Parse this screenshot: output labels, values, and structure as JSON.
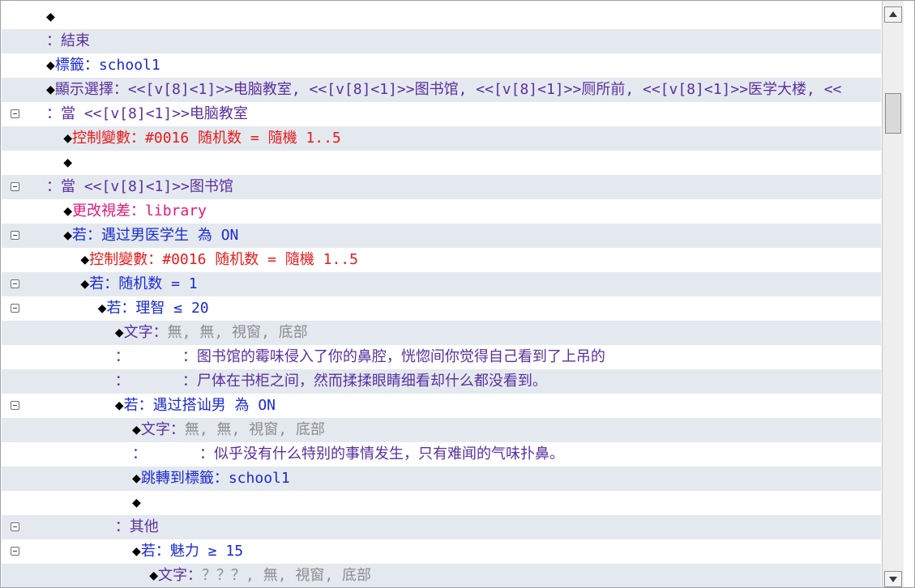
{
  "lines": [
    {
      "indent": 0,
      "fold": false,
      "segs": [
        {
          "t": "◆",
          "c": "dia"
        }
      ]
    },
    {
      "indent": 0,
      "fold": false,
      "segs": [
        {
          "t": "：結束",
          "c": "p"
        }
      ]
    },
    {
      "indent": 0,
      "fold": false,
      "segs": [
        {
          "t": "◆",
          "c": "dia"
        },
        {
          "t": "標籤：school1",
          "c": "b"
        }
      ]
    },
    {
      "indent": 0,
      "fold": false,
      "segs": [
        {
          "t": "◆",
          "c": "dia"
        },
        {
          "t": "顯示選擇：<<[v[8]<1]>>电脑教室, <<[v[8]<1]>>图书馆, <<[v[8]<1]>>厕所前, <<[v[8]<1]>>医学大楼, <<",
          "c": "p"
        }
      ]
    },
    {
      "indent": 0,
      "fold": true,
      "segs": [
        {
          "t": "：當 <<[v[8]<1]>>电脑教室",
          "c": "p"
        }
      ]
    },
    {
      "indent": 1,
      "fold": false,
      "segs": [
        {
          "t": "◆",
          "c": "dia"
        },
        {
          "t": "控制變數：#0016 随机数 = 隨機 1..5",
          "c": "r"
        }
      ]
    },
    {
      "indent": 1,
      "fold": false,
      "segs": [
        {
          "t": "◆",
          "c": "dia"
        }
      ]
    },
    {
      "indent": 0,
      "fold": true,
      "segs": [
        {
          "t": "：當 <<[v[8]<1]>>图书馆",
          "c": "p"
        }
      ]
    },
    {
      "indent": 1,
      "fold": false,
      "segs": [
        {
          "t": "◆",
          "c": "dia"
        },
        {
          "t": "更改視差：library",
          "c": "m"
        }
      ]
    },
    {
      "indent": 1,
      "fold": true,
      "segs": [
        {
          "t": "◆",
          "c": "dia"
        },
        {
          "t": "若：遇过男医学生 為 ON",
          "c": "b"
        }
      ]
    },
    {
      "indent": 2,
      "fold": false,
      "segs": [
        {
          "t": "◆",
          "c": "dia"
        },
        {
          "t": "控制變數：#0016 随机数 = 隨機 1..5",
          "c": "r"
        }
      ]
    },
    {
      "indent": 2,
      "fold": true,
      "segs": [
        {
          "t": "◆",
          "c": "dia"
        },
        {
          "t": "若：随机数 = 1",
          "c": "b"
        }
      ]
    },
    {
      "indent": 3,
      "fold": true,
      "segs": [
        {
          "t": "◆",
          "c": "dia"
        },
        {
          "t": "若：理智 ≤ 20",
          "c": "b"
        }
      ]
    },
    {
      "indent": 4,
      "fold": false,
      "segs": [
        {
          "t": "◆",
          "c": "dia"
        },
        {
          "t": "文字：",
          "c": "p"
        },
        {
          "t": "無, 無, 視窗, 底部",
          "c": "g"
        }
      ]
    },
    {
      "indent": 4,
      "fold": false,
      "segs": [
        {
          "t": "：      ：图书馆的霉味侵入了你的鼻腔，恍惚间你觉得自己看到了上吊的",
          "c": "p"
        }
      ]
    },
    {
      "indent": 4,
      "fold": false,
      "segs": [
        {
          "t": "：      ：尸体在书柜之间，然而揉揉眼睛细看却什么都没看到。",
          "c": "p"
        }
      ]
    },
    {
      "indent": 4,
      "fold": true,
      "segs": [
        {
          "t": "◆",
          "c": "dia"
        },
        {
          "t": "若：遇过搭讪男 為 ON",
          "c": "b"
        }
      ]
    },
    {
      "indent": 5,
      "fold": false,
      "segs": [
        {
          "t": "◆",
          "c": "dia"
        },
        {
          "t": "文字：",
          "c": "p"
        },
        {
          "t": "無, 無, 視窗, 底部",
          "c": "g"
        }
      ]
    },
    {
      "indent": 5,
      "fold": false,
      "segs": [
        {
          "t": "：      ：似乎没有什么特别的事情发生，只有难闻的气味扑鼻。",
          "c": "p"
        }
      ]
    },
    {
      "indent": 5,
      "fold": false,
      "segs": [
        {
          "t": "◆",
          "c": "dia"
        },
        {
          "t": "跳轉到標籤：school1",
          "c": "b"
        }
      ]
    },
    {
      "indent": 5,
      "fold": false,
      "segs": [
        {
          "t": "◆",
          "c": "dia"
        }
      ]
    },
    {
      "indent": 4,
      "fold": true,
      "segs": [
        {
          "t": "：其他",
          "c": "p"
        }
      ]
    },
    {
      "indent": 5,
      "fold": true,
      "segs": [
        {
          "t": "◆",
          "c": "dia"
        },
        {
          "t": "若：魅力 ≥ 15",
          "c": "b"
        }
      ]
    },
    {
      "indent": 6,
      "fold": false,
      "segs": [
        {
          "t": "◆",
          "c": "dia"
        },
        {
          "t": "文字：",
          "c": "p"
        },
        {
          "t": "？？？, 無, 視窗, 底部",
          "c": "g"
        }
      ]
    }
  ],
  "icons": {
    "fold": "collapse-icon",
    "scroll_up": "arrow-up-icon",
    "scroll_down": "arrow-down-icon"
  },
  "colors": {
    "purple": "#5a2fa0",
    "blue": "#1a2ad6",
    "red": "#e81a1a",
    "magenta": "#e0187a",
    "gray": "#8c8c8c",
    "row_alt": "#e4e9ef"
  }
}
